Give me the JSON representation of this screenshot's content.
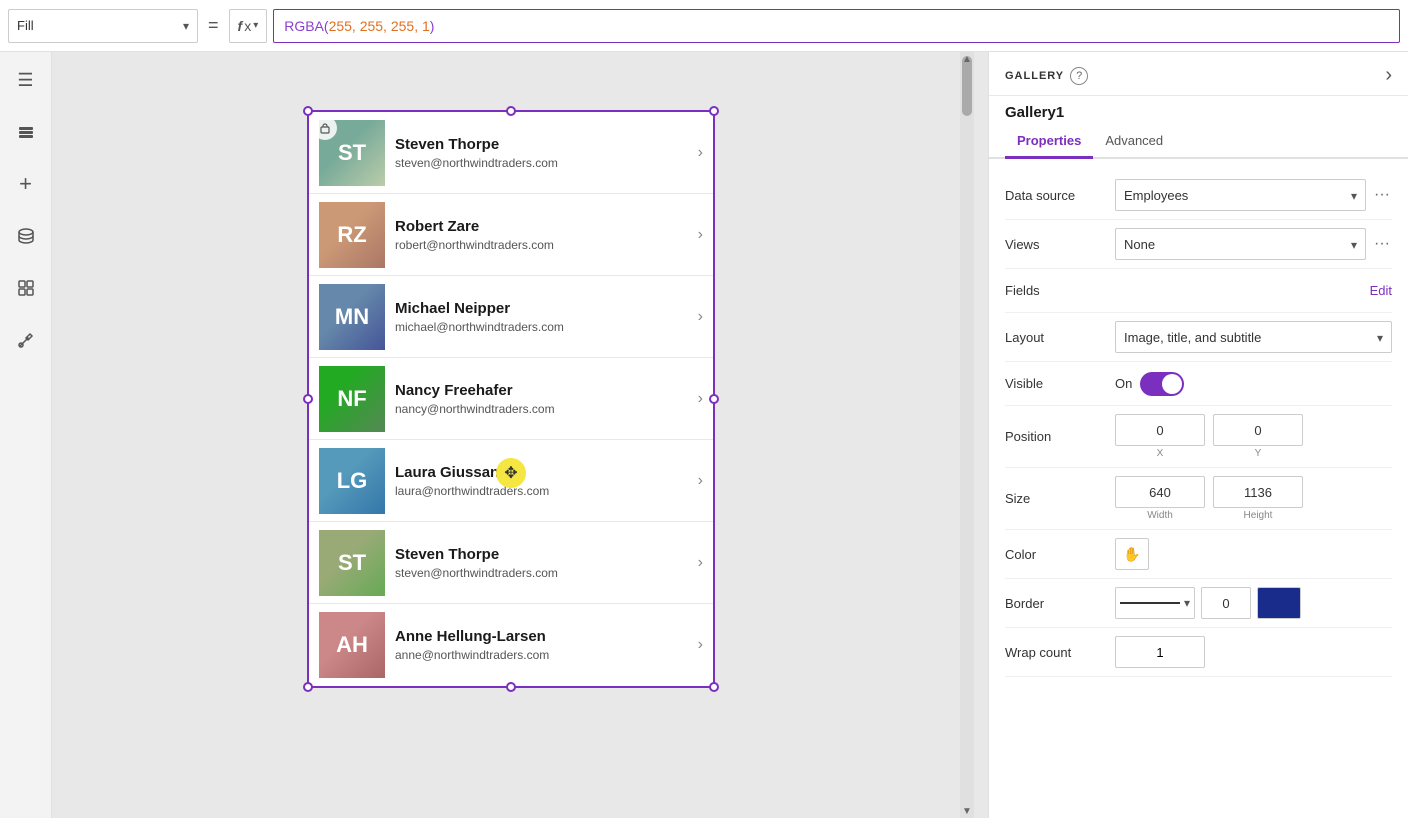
{
  "toolbar": {
    "fill_label": "Fill",
    "equals": "=",
    "fx_label": "fx",
    "formula": "RGBA(255, 255, 255, 1)"
  },
  "left_sidebar": {
    "icons": [
      {
        "name": "hamburger-icon",
        "glyph": "☰"
      },
      {
        "name": "layers-icon",
        "glyph": "⧉"
      },
      {
        "name": "plus-icon",
        "glyph": "+"
      },
      {
        "name": "database-icon",
        "glyph": "🗄"
      },
      {
        "name": "component-icon",
        "glyph": "⊞"
      },
      {
        "name": "wrench-icon",
        "glyph": "🔧"
      }
    ]
  },
  "gallery": {
    "items": [
      {
        "name": "Steven Thorpe",
        "email": "steven@northwindtraders.com",
        "avatar_label": "ST",
        "avatar_class": "avatar-1"
      },
      {
        "name": "Robert Zare",
        "email": "robert@northwindtraders.com",
        "avatar_label": "RZ",
        "avatar_class": "avatar-2"
      },
      {
        "name": "Michael Neipper",
        "email": "michael@northwindtraders.com",
        "avatar_label": "MN",
        "avatar_class": "avatar-3"
      },
      {
        "name": "Nancy Freehafer",
        "email": "nancy@northwindtraders.com",
        "avatar_label": "NF",
        "avatar_class": "avatar-4"
      },
      {
        "name": "Laura Giussani",
        "email": "laura@northwindtraders.com",
        "avatar_label": "LG",
        "avatar_class": "avatar-5"
      },
      {
        "name": "Steven Thorpe",
        "email": "steven@northwindtraders.com",
        "avatar_label": "ST",
        "avatar_class": "avatar-6"
      },
      {
        "name": "Anne Hellung-Larsen",
        "email": "anne@northwindtraders.com",
        "avatar_label": "AH",
        "avatar_class": "avatar-7"
      }
    ]
  },
  "right_panel": {
    "section_label": "GALLERY",
    "help_label": "?",
    "gallery_name": "Gallery1",
    "tabs": [
      {
        "label": "Properties",
        "active": true
      },
      {
        "label": "Advanced",
        "active": false
      }
    ],
    "properties": {
      "data_source_label": "Data source",
      "data_source_value": "Employees",
      "views_label": "Views",
      "views_value": "None",
      "fields_label": "Fields",
      "fields_edit": "Edit",
      "layout_label": "Layout",
      "layout_value": "Image, title, and subtitle",
      "visible_label": "Visible",
      "visible_state": "On",
      "position_label": "Position",
      "pos_x": "0",
      "pos_x_label": "X",
      "pos_y": "0",
      "pos_y_label": "Y",
      "size_label": "Size",
      "size_w": "640",
      "size_w_label": "Width",
      "size_h": "1136",
      "size_h_label": "Height",
      "color_label": "Color",
      "color_icon": "✋",
      "border_label": "Border",
      "border_val": "0",
      "wrap_count_label": "Wrap count",
      "wrap_count_val": "1"
    },
    "collapse_icon": "›"
  }
}
